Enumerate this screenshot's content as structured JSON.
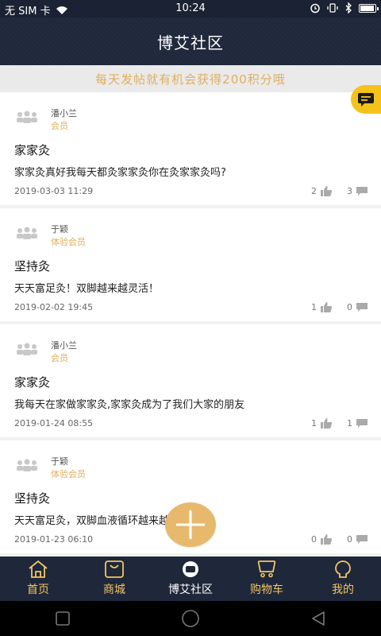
{
  "status_bar": {
    "carrier": "无 SIM 卡",
    "time": "10:24",
    "right_icons": [
      "alarm-icon",
      "vibrate-icon",
      "bluetooth-icon",
      "battery-icon"
    ]
  },
  "header": {
    "title": "博艾社区"
  },
  "banner": {
    "text": "每天发帖就有机会获得200积分哦"
  },
  "posts": [
    {
      "username": "潘小兰",
      "role": "会员",
      "title": "家家灸",
      "body": "家家灸真好我每天都灸家家灸你在灸家家灸吗?",
      "date": "2019-03-03 11:29",
      "likes": "2",
      "comments": "3"
    },
    {
      "username": "于颖",
      "role": "体验会员",
      "title": "坚持灸",
      "body": "天天富足灸！双脚越来越灵活！",
      "date": "2019-02-02 19:45",
      "likes": "1",
      "comments": "0"
    },
    {
      "username": "潘小兰",
      "role": "会员",
      "title": "家家灸",
      "body": "我每天在家做家家灸,家家灸成为了我们大家的朋友",
      "date": "2019-01-24 08:55",
      "likes": "1",
      "comments": "1"
    },
    {
      "username": "于颖",
      "role": "体验会员",
      "title": "坚持灸",
      "body": "天天富足灸，双脚血液循环越来越好了！",
      "date": "2019-01-23 06:10",
      "likes": "0",
      "comments": "0"
    }
  ],
  "tabs": [
    {
      "label": "首页",
      "icon": "home-icon"
    },
    {
      "label": "商城",
      "icon": "bag-icon"
    },
    {
      "label": "博艾社区",
      "icon": "community-icon",
      "active": true
    },
    {
      "label": "购物车",
      "icon": "cart-icon"
    },
    {
      "label": "我的",
      "icon": "profile-icon"
    }
  ],
  "colors": {
    "header_bg": "#1f273a",
    "accent_gold": "#e2ae5c",
    "fab_yellow": "#f4c21b"
  }
}
